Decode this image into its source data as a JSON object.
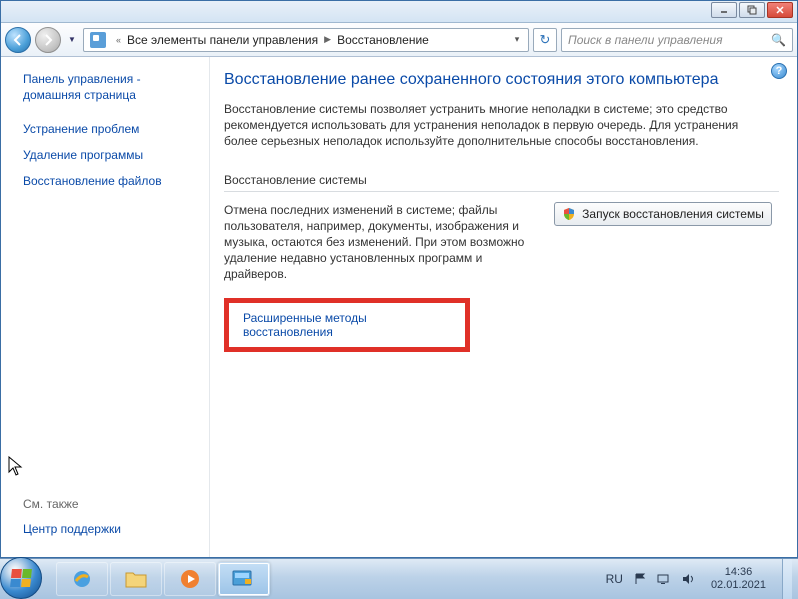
{
  "window_controls": {
    "min": "_",
    "max": "☐",
    "close": "✕"
  },
  "breadcrumb": {
    "root": "Все элементы панели управления",
    "leaf": "Восстановление"
  },
  "search": {
    "placeholder": "Поиск в панели управления"
  },
  "sidebar": {
    "home_line1": "Панель управления -",
    "home_line2": "домашняя страница",
    "items": [
      "Устранение проблем",
      "Удаление программы",
      "Восстановление файлов"
    ],
    "see_also_label": "См. также",
    "see_also_items": [
      "Центр поддержки"
    ]
  },
  "content": {
    "title": "Восстановление ранее сохраненного состояния этого компьютера",
    "desc": "Восстановление системы позволяет устранить многие неполадки в системе; это средство рекомендуется использовать для устранения неполадок в первую очередь. Для устранения более серьезных неполадок используйте дополнительные способы восстановления.",
    "section_title": "Восстановление системы",
    "restore_desc": "Отмена последних изменений в системе; файлы пользователя, например, документы, изображения и музыка, остаются без изменений. При этом возможно удаление недавно установленных программ и драйверов.",
    "action_button": "Запуск восстановления системы",
    "advanced_link": "Расширенные методы восстановления"
  },
  "taskbar": {
    "lang": "RU",
    "time": "14:36",
    "date": "02.01.2021"
  },
  "help_icon": "?"
}
